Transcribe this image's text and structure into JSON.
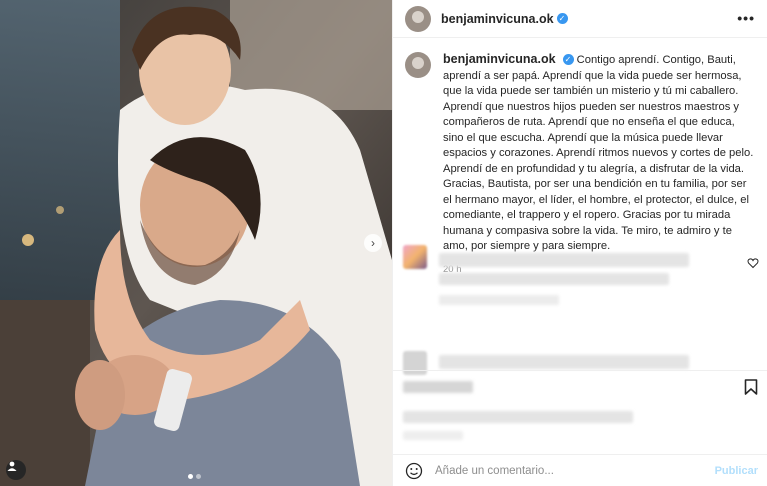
{
  "post": {
    "username": "benjaminvicuna.ok",
    "verified": true,
    "caption": "Contigo aprendí. Contigo, Bauti, aprendí a ser papá. Aprendí que la vida puede ser hermosa, que la vida puede ser también un misterio y tú mi caballero. Aprendí que nuestros hijos pueden ser nuestros maestros y compañeros de ruta. Aprendí que no enseña el que educa, sino el que escucha. Aprendí que la música puede llevar espacios y corazones. Aprendí ritmos nuevos y cortes de pelo. Aprendí de en profundidad y tu alegría, a disfrutar de la vida. Gracias, Bautista, por ser una bendición en tu familia, por ser el hermano mayor, el líder, el hombre, el protector, el dulce, el comediante, el trappero y el ropero. Gracias por tu mirada humana y compasiva sobre la vida. Te miro, te admiro y te amo, por siempre y para siempre.",
    "time_ago": "20 h"
  },
  "media": {
    "slide_count": 2,
    "active_slide": 1
  },
  "comment_box": {
    "placeholder": "Añade un comentario...",
    "publish_label": "Publicar"
  },
  "icons": {
    "more": "more-options-icon",
    "verified": "verified-badge-icon",
    "next": "chevron-right-icon",
    "heart": "heart-icon",
    "bookmark": "bookmark-icon",
    "emoji": "emoji-icon",
    "tagged": "user-tag-icon"
  },
  "colors": {
    "verified": "#3897f0",
    "publish_disabled": "#b2dffc",
    "muted_text": "#8e8e8e"
  }
}
